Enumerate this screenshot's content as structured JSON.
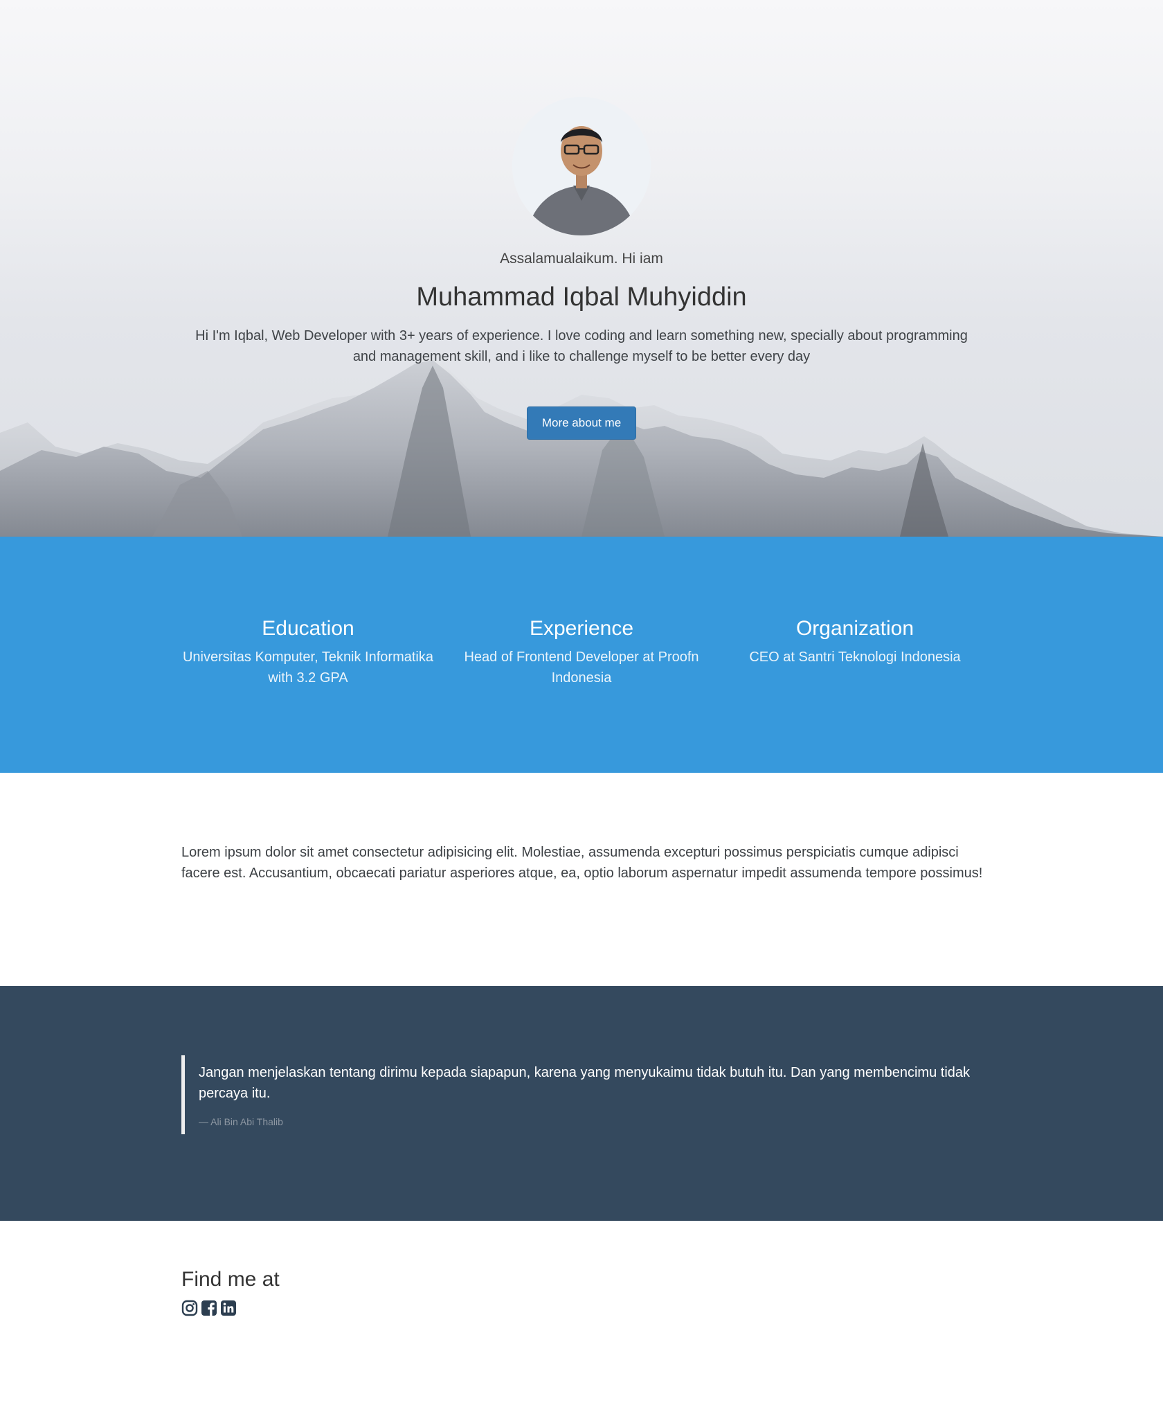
{
  "hero": {
    "greeting": "Assalamualaikum. Hi iam",
    "name": "Muhammad Iqbal Muhyiddin",
    "bio": "Hi I'm Iqbal, Web Developer with 3+ years of experience. I love coding and learn something new, specially about programming and management skill, and i like to challenge myself to be better every day",
    "button_label": "More about me"
  },
  "stats": [
    {
      "title": "Education",
      "text": "Universitas Komputer, Teknik Informatika with 3.2 GPA"
    },
    {
      "title": "Experience",
      "text": "Head of Frontend Developer at Proofn Indonesia"
    },
    {
      "title": "Organization",
      "text": "CEO at Santri Teknologi Indonesia"
    }
  ],
  "about": {
    "text": "Lorem ipsum dolor sit amet consectetur adipisicing elit. Molestiae, assumenda excepturi possimus perspiciatis cumque adipisci facere est. Accusantium, obcaecati pariatur asperiores atque, ea, optio laborum aspernatur impedit assumenda tempore possimus!"
  },
  "quote": {
    "text": "Jangan menjelaskan tentang dirimu kepada siapapun, karena yang menyukaimu tidak butuh itu. Dan yang membencimu tidak percaya itu.",
    "author": "— Ali Bin Abi Thalib"
  },
  "find": {
    "title": "Find me at",
    "icons": [
      "instagram-icon",
      "facebook-icon",
      "linkedin-icon"
    ]
  },
  "colors": {
    "stats_bg": "#3799dc",
    "quote_bg": "#34495e",
    "button_bg": "#337ab7",
    "icon_color": "#2c3e50"
  }
}
